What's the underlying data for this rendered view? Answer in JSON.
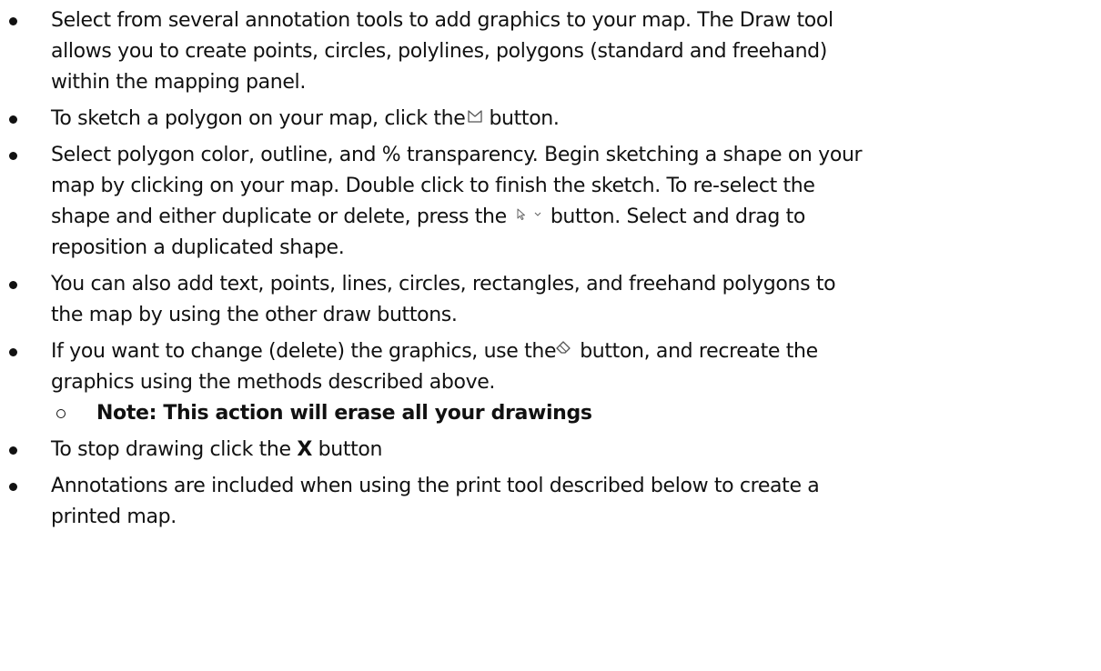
{
  "doc": {
    "b1": {
      "l1": "Select from several annotation tools to add graphics to your map. The Draw tool",
      "l2": "allows you to create points, circles, polylines, polygons (standard and freehand)",
      "l3": "within the mapping panel."
    },
    "b2": {
      "pre": "To sketch a polygon on your map, click the",
      "icon": "polygon-draw-icon",
      "post": "button."
    },
    "b3": {
      "l1": "Select polygon color, outline, and % transparency.  Begin sketching a shape on your",
      "l2": "map by clicking on your map. Double click to finish the sketch. To re-select the",
      "l3_pre": "shape and either duplicate or delete, press the",
      "icon": "select-pointer-dropdown-icon",
      "l3_post": "button. Select and drag to",
      "l4": "reposition a duplicated shape."
    },
    "b4": {
      "l1": "You can also add text, points, lines, circles, rectangles, and freehand polygons to",
      "l2": "the map by using the other draw buttons."
    },
    "b5": {
      "l1_pre": "If you want to change (delete) the graphics, use the",
      "icon": "eraser-icon",
      "l1_post": "button, and recreate the",
      "l2": "graphics using the methods described above.",
      "note": "Note: This action will erase all your drawings"
    },
    "b6": {
      "pre": "To stop drawing click the",
      "key": "X",
      "post": "button"
    },
    "b7": {
      "l1": "Annotations are included when using the print tool described below to create a",
      "l2": "printed map."
    }
  }
}
